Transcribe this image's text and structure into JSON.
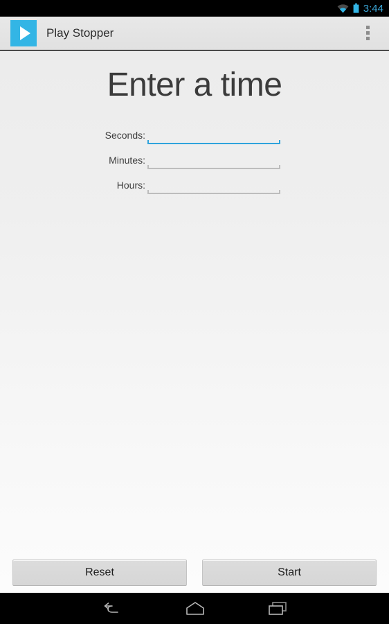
{
  "status_bar": {
    "clock": "3:44",
    "clock_color": "#3aa5d6",
    "wifi_icon": "wifi-icon",
    "battery_icon": "battery-icon",
    "background": "#000000"
  },
  "action_bar": {
    "app_icon": "play-icon",
    "app_icon_color": "#33b5e5",
    "title": "Play Stopper",
    "overflow_icon": "overflow-menu-icon",
    "background": "#e4e4e4"
  },
  "main": {
    "heading": "Enter a time",
    "fields": [
      {
        "label": "Seconds:",
        "value": "",
        "placeholder": "",
        "focused": true
      },
      {
        "label": "Minutes:",
        "value": "",
        "placeholder": "",
        "focused": false
      },
      {
        "label": "Hours:",
        "value": "",
        "placeholder": "",
        "focused": false
      }
    ],
    "focus_accent_color": "#2fa3dc",
    "idle_underline_color": "#bdbdbd"
  },
  "buttons": {
    "reset_label": "Reset",
    "start_label": "Start"
  },
  "nav_bar": {
    "back_icon": "back-arrow-icon",
    "home_icon": "home-icon",
    "recents_icon": "recents-icon",
    "background": "#000000"
  }
}
